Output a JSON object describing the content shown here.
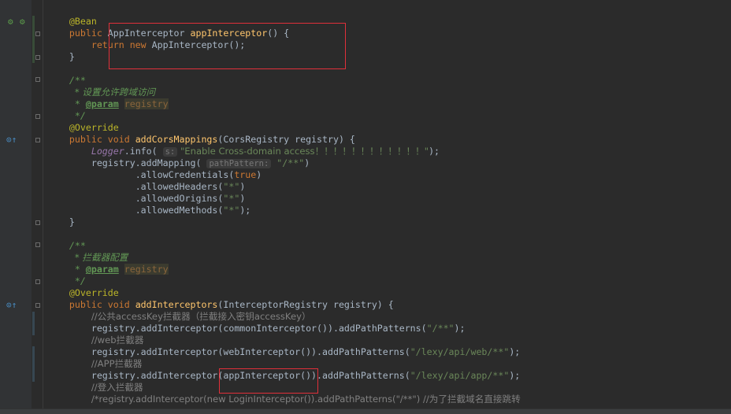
{
  "editor": {
    "lines": [
      {
        "indent": "    ",
        "parts": [
          {
            "t": "ann",
            "v": "@Bean"
          }
        ]
      },
      {
        "indent": "    ",
        "parts": [
          {
            "t": "kw",
            "v": "public "
          },
          {
            "t": "",
            "v": "AppInterceptor "
          },
          {
            "t": "fn",
            "v": "appInterceptor"
          },
          {
            "t": "",
            "v": "() {"
          }
        ]
      },
      {
        "indent": "        ",
        "parts": [
          {
            "t": "kw",
            "v": "return new "
          },
          {
            "t": "",
            "v": "AppInterceptor();"
          }
        ]
      },
      {
        "indent": "    ",
        "parts": [
          {
            "t": "",
            "v": "}"
          }
        ]
      },
      {
        "indent": "",
        "parts": []
      },
      {
        "indent": "    ",
        "parts": [
          {
            "t": "doc",
            "v": "/**"
          }
        ]
      },
      {
        "indent": "     ",
        "parts": [
          {
            "t": "doc",
            "v": "* 设置允许跨域访问"
          }
        ]
      },
      {
        "indent": "     ",
        "parts": [
          {
            "t": "doc",
            "v": "* "
          },
          {
            "t": "doctag",
            "v": "@param"
          },
          {
            "t": "doc",
            "v": " "
          },
          {
            "t": "docparam",
            "v": "registry"
          }
        ]
      },
      {
        "indent": "     ",
        "parts": [
          {
            "t": "doc",
            "v": "*/"
          }
        ]
      },
      {
        "indent": "    ",
        "parts": [
          {
            "t": "ann",
            "v": "@Override"
          }
        ]
      },
      {
        "indent": "    ",
        "parts": [
          {
            "t": "kw",
            "v": "public void "
          },
          {
            "t": "fn",
            "v": "addCorsMappings"
          },
          {
            "t": "",
            "v": "(CorsRegistry registry) {"
          }
        ]
      },
      {
        "indent": "        ",
        "parts": [
          {
            "t": "field",
            "v": "Logger"
          },
          {
            "t": "",
            "v": ".info( "
          },
          {
            "t": "hint",
            "v": "s:"
          },
          {
            "t": "str",
            "v": " \"Enable Cross-domain access！！！！！！！！！！！！\""
          },
          {
            "t": "",
            "v": ");"
          }
        ]
      },
      {
        "indent": "        ",
        "parts": [
          {
            "t": "",
            "v": "registry.addMapping( "
          },
          {
            "t": "hint",
            "v": "pathPattern:"
          },
          {
            "t": "str",
            "v": " \"/**\""
          },
          {
            "t": "",
            "v": ")"
          }
        ]
      },
      {
        "indent": "                ",
        "parts": [
          {
            "t": "",
            "v": ".allowCredentials("
          },
          {
            "t": "kw",
            "v": "true"
          },
          {
            "t": "",
            "v": ")"
          }
        ]
      },
      {
        "indent": "                ",
        "parts": [
          {
            "t": "",
            "v": ".allowedHeaders("
          },
          {
            "t": "str",
            "v": "\"*\""
          },
          {
            "t": "",
            "v": ")"
          }
        ]
      },
      {
        "indent": "                ",
        "parts": [
          {
            "t": "",
            "v": ".allowedOrigins("
          },
          {
            "t": "str",
            "v": "\"*\""
          },
          {
            "t": "",
            "v": ")"
          }
        ]
      },
      {
        "indent": "                ",
        "parts": [
          {
            "t": "",
            "v": ".allowedMethods("
          },
          {
            "t": "str",
            "v": "\"*\""
          },
          {
            "t": "",
            "v": ");"
          }
        ]
      },
      {
        "indent": "    ",
        "parts": [
          {
            "t": "",
            "v": "}"
          }
        ]
      },
      {
        "indent": "",
        "parts": []
      },
      {
        "indent": "    ",
        "parts": [
          {
            "t": "doc",
            "v": "/**"
          }
        ]
      },
      {
        "indent": "     ",
        "parts": [
          {
            "t": "doc",
            "v": "* 拦截器配置"
          }
        ]
      },
      {
        "indent": "     ",
        "parts": [
          {
            "t": "doc",
            "v": "* "
          },
          {
            "t": "doctag",
            "v": "@param"
          },
          {
            "t": "doc",
            "v": " "
          },
          {
            "t": "docparam",
            "v": "registry"
          }
        ]
      },
      {
        "indent": "     ",
        "parts": [
          {
            "t": "doc",
            "v": "*/"
          }
        ]
      },
      {
        "indent": "    ",
        "parts": [
          {
            "t": "ann",
            "v": "@Override"
          }
        ]
      },
      {
        "indent": "    ",
        "parts": [
          {
            "t": "kw",
            "v": "public void "
          },
          {
            "t": "fn",
            "v": "addInterceptors"
          },
          {
            "t": "",
            "v": "(InterceptorRegistry registry) {"
          }
        ]
      },
      {
        "indent": "        ",
        "parts": [
          {
            "t": "cmt",
            "v": "//公共accessKey拦截器（拦截接入密钥accessKey）"
          }
        ]
      },
      {
        "indent": "        ",
        "parts": [
          {
            "t": "",
            "v": "registry.addInterceptor(commonInterceptor()).addPathPatterns("
          },
          {
            "t": "str",
            "v": "\"/**\""
          },
          {
            "t": "",
            "v": ");"
          }
        ]
      },
      {
        "indent": "        ",
        "parts": [
          {
            "t": "cmt",
            "v": "//web拦截器"
          }
        ]
      },
      {
        "indent": "        ",
        "parts": [
          {
            "t": "",
            "v": "registry.addInterceptor(webInterceptor()).addPathPatterns("
          },
          {
            "t": "str",
            "v": "\"/lexy/api/web/**\""
          },
          {
            "t": "",
            "v": ");"
          }
        ]
      },
      {
        "indent": "        ",
        "parts": [
          {
            "t": "cmt",
            "v": "//APP拦截器"
          }
        ]
      },
      {
        "indent": "        ",
        "parts": [
          {
            "t": "",
            "v": "registry.addInterceptor(appInterceptor()).addPathPatterns("
          },
          {
            "t": "str",
            "v": "\"/lexy/api/app/**\""
          },
          {
            "t": "",
            "v": ");"
          }
        ]
      },
      {
        "indent": "        ",
        "parts": [
          {
            "t": "cmt",
            "v": "//登入拦截器"
          }
        ]
      },
      {
        "indent": "        ",
        "parts": [
          {
            "t": "cmt",
            "v": "/*registry.addInterceptor(new LoginInterceptor()).addPathPatterns(\"/**\") //为了拦截域名直接跳转"
          }
        ]
      }
    ]
  },
  "gutter_icons": [
    {
      "name": "bean-icon",
      "glyph": "⚙",
      "color": "#5a9a4a"
    },
    {
      "name": "override-up-icon",
      "glyph": "⊙↑",
      "color": "#4a90c8"
    },
    {
      "name": "override-up-icon",
      "glyph": "⊙↑",
      "color": "#4a90c8"
    }
  ],
  "colors": {
    "background": "#2b2b2b",
    "keyword": "#cc7832",
    "annotation": "#bbb529",
    "method": "#ffc66d",
    "string": "#6a8759",
    "highlight_box": "#e0303a"
  }
}
